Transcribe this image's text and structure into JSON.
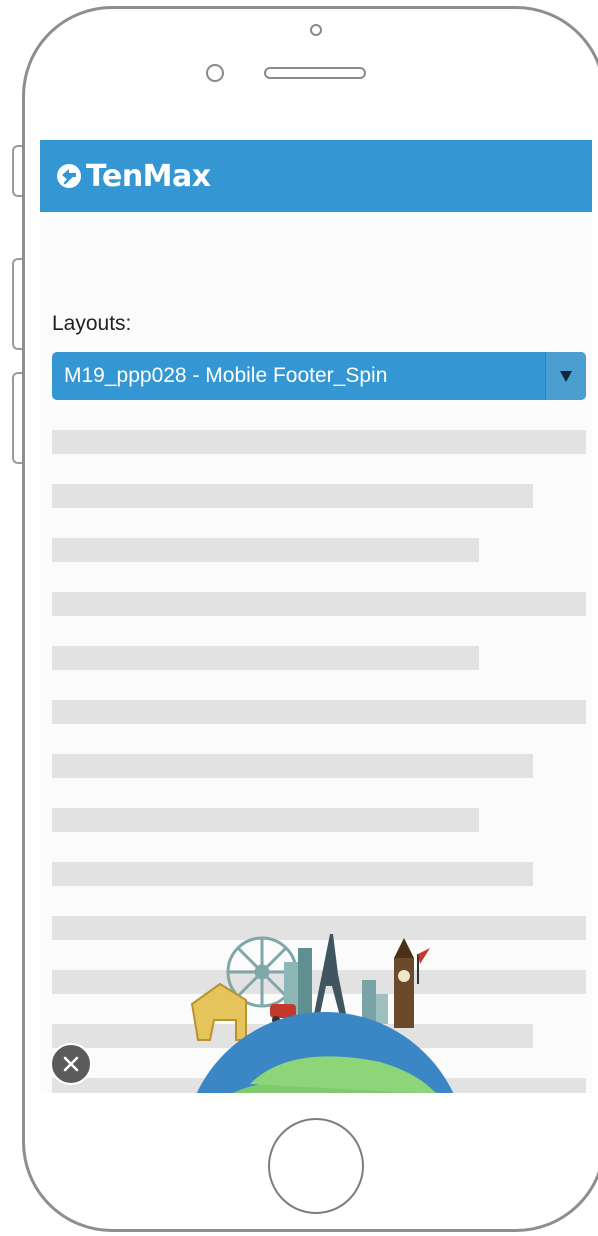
{
  "header": {
    "brand": "TenMax",
    "background_color": "#3497d3",
    "logo_icon": "tenmax-logo-icon"
  },
  "layouts": {
    "label": "Layouts:",
    "selected_value": "M19_ppp028 - Mobile Footer_Spin",
    "arrow_icon": "triangle-down-icon"
  },
  "placeholder_color": "#e2e2e2",
  "ad": {
    "image_icon": "travel-globe-landmarks-illustration",
    "close_icon": "close-icon"
  }
}
